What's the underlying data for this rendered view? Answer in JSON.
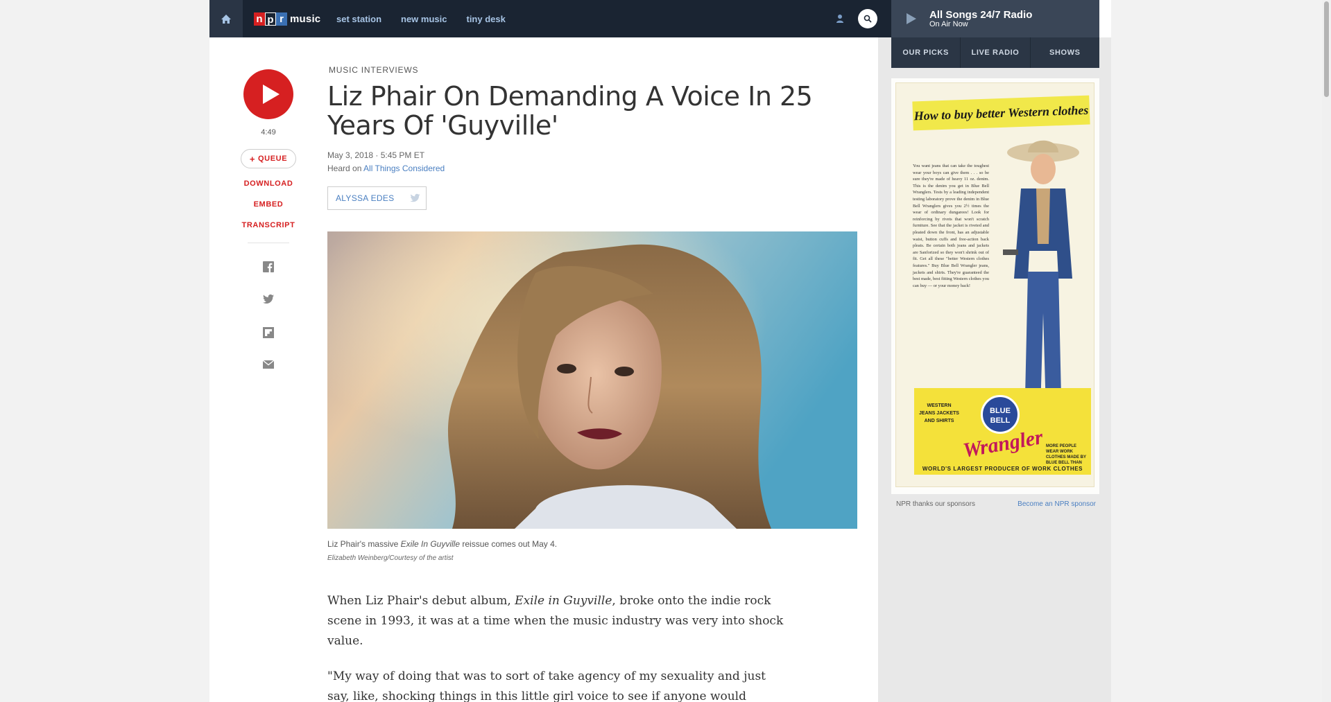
{
  "nav": {
    "logo_npr": [
      "n",
      "p",
      "r"
    ],
    "logo_music": "music",
    "links": [
      "set station",
      "new music",
      "tiny desk"
    ]
  },
  "player": {
    "title": "All Songs 24/7 Radio",
    "subtitle": "On Air Now",
    "tabs": [
      "OUR PICKS",
      "LIVE RADIO",
      "SHOWS"
    ]
  },
  "actions": {
    "duration": "4:49",
    "queue": "QUEUE",
    "download": "DOWNLOAD",
    "embed": "EMBED",
    "transcript": "TRANSCRIPT",
    "share_icons": [
      "facebook-icon",
      "twitter-icon",
      "flipboard-icon",
      "email-icon"
    ]
  },
  "article": {
    "slug": "MUSIC INTERVIEWS",
    "headline": "Liz Phair On Demanding A Voice In 25 Years Of 'Guyville'",
    "date": "May 3, 2018 · 5:45 PM ET",
    "heard_prefix": "Heard on",
    "heard_show": "All Things Considered",
    "byline": "ALYSSA EDES",
    "caption_pre": "Liz Phair's massive ",
    "caption_em": "Exile In Guyville",
    "caption_post": " reissue comes out May 4.",
    "credit": "Elizabeth Weinberg/Courtesy of the artist",
    "p1_pre": "When Liz Phair's debut album, ",
    "p1_em": "Exile in Guyville",
    "p1_post": ", broke onto the indie rock scene in 1993, it was at a time when the music industry was very into shock value.",
    "p2": "\"My way of doing that was to sort of take agency of my sexuality and just say, like, shocking things in this little girl voice to see if anyone would"
  },
  "ad": {
    "banner": "How to buy better Western clothes",
    "copy": "You want jeans that can take the toughest wear your boys can give them . . . so be sure they're made of heavy 11 oz. denim. This is the denim you get in Blue Bell Wranglers. Tests by a leading independent testing laboratory prove the denim in Blue Bell Wranglers gives you 2½ times the wear of ordinary dungarees! Look for reinforcing by rivets that won't scratch furniture. See that the jacket is riveted and pleated down the front, has an adjustable waist, button cuffs and free-action back pleats. Be certain both jeans and jackets are Sanforized so they won't shrink out of fit. Get all these \"better Western clothes features.\" Buy Blue Bell Wrangler jeans, jackets and shirts. They're guaranteed the best made, best fitting Western clothes you can buy — or your money back!",
    "box_left": "WESTERN JEANS JACKETS AND SHIRTS",
    "bell": "BLUE BELL",
    "wrangler": "Wrangler",
    "box_right": "MORE PEOPLE WEAR WORK CLOTHES MADE BY BLUE BELL THAN ANY OTHER MAKE",
    "box_bottom": "WORLD'S LARGEST PRODUCER OF WORK CLOTHES",
    "footer_left": "NPR thanks our sponsors",
    "footer_right": "Become an NPR sponsor"
  },
  "colors": {
    "npr_red": "#d62021",
    "nav_bg": "#1a2432",
    "link_blue": "#4a7fc1"
  }
}
